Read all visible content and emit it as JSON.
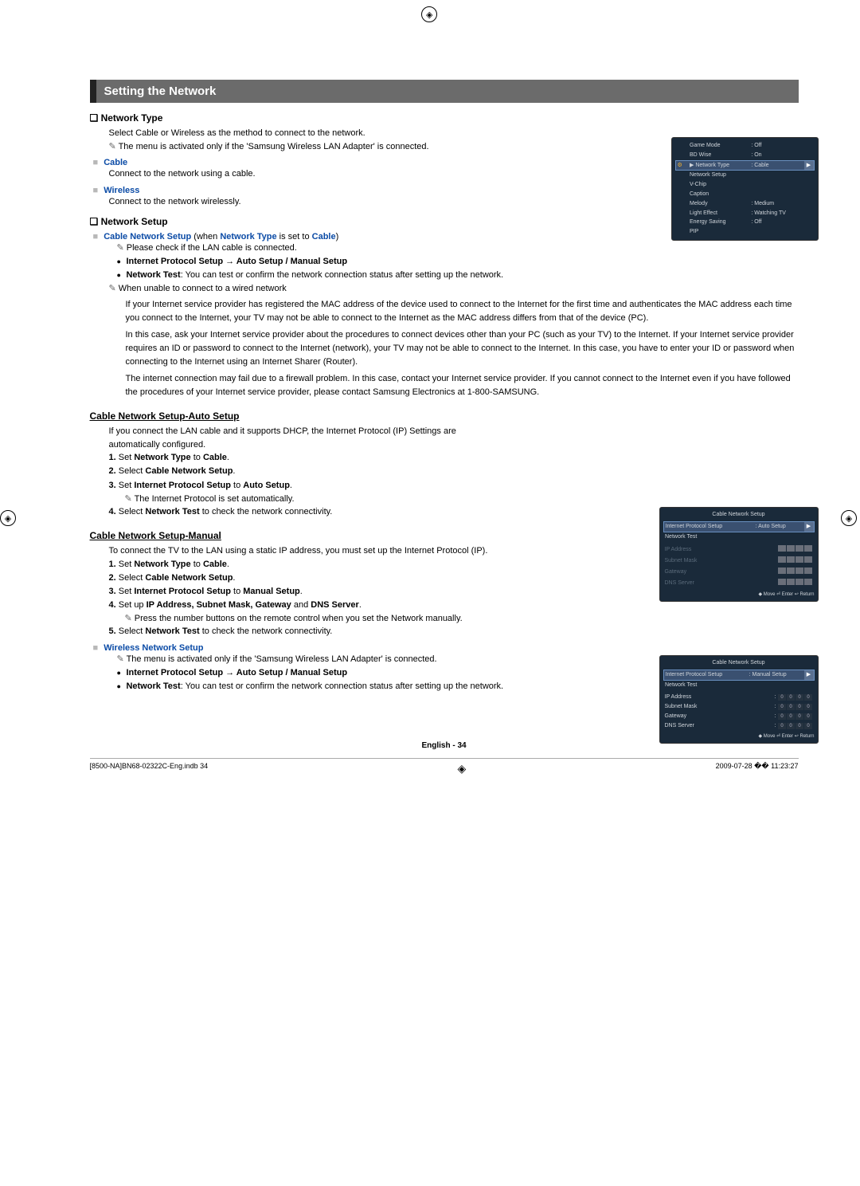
{
  "header": "Setting the Network",
  "network_type": {
    "heading": "Network Type",
    "intro": "Select Cable or Wireless as the method to connect to the network.",
    "note": "The menu is activated only if the 'Samsung Wireless LAN Adapter' is connected.",
    "cable_label": "Cable",
    "cable_text": "Connect to the network using a cable.",
    "wireless_label": "Wireless",
    "wireless_text": "Connect to the network wirelessly."
  },
  "network_setup": {
    "heading": "Network Setup",
    "cable_setup": "Cable Network Setup (when Network Type is set to Cable)",
    "check_lan": "Please check if the LAN cable is connected.",
    "ip_setup": "Internet Protocol Setup → Auto Setup / Manual Setup",
    "network_test_label": "Network Test",
    "network_test": ": You can test or confirm the network connection status after setting up the network.",
    "unable": "When unable to connect to a wired network",
    "para1": "If your Internet service provider has registered the MAC address of the device used to connect to the Internet for the first time and authenticates the MAC address each time you connect to the Internet, your TV may not be able to connect to the Internet as the MAC address differs from that of the device (PC).",
    "para2": "In this case, ask your Internet service provider about the procedures to connect devices other than your PC (such as your TV) to the Internet. If your Internet service provider requires an ID or password to connect to the Internet (network), your TV may not be able to connect to the Internet. In this case, you have to enter your ID or password when connecting to the Internet using an Internet Sharer (Router).",
    "para3": "The internet connection may fail due to a firewall problem. In this case, contact your Internet service provider. If you cannot connect to the Internet even if you have followed the procedures of your Internet service provider, please contact Samsung Electronics at 1-800-SAMSUNG."
  },
  "auto_setup": {
    "heading": "Cable Network Setup-Auto Setup",
    "intro": "If you connect the LAN cable and it supports DHCP, the Internet Protocol (IP) Settings are automatically configured.",
    "step1_pre": "Set ",
    "step1_b1": "Network Type",
    "step1_mid": " to ",
    "step1_b2": "Cable",
    "step1_end": ".",
    "step2_pre": "Select ",
    "step2_b": "Cable Network Setup",
    "step2_end": ".",
    "step3_pre": "Set ",
    "step3_b1": "Internet Protocol Setup",
    "step3_mid": " to ",
    "step3_b2": "Auto Setup",
    "step3_end": ".",
    "step3_note": "The Internet Protocol is set automatically.",
    "step4_pre": "Select ",
    "step4_b": "Network Test",
    "step4_end": " to check the network connectivity."
  },
  "manual_setup": {
    "heading": "Cable Network Setup-Manual",
    "intro": "To connect the TV to the LAN using a static IP address, you must set up the Internet Protocol (IP).",
    "step1_pre": "Set ",
    "step1_b1": "Network Type",
    "step1_mid": " to ",
    "step1_b2": "Cable",
    "step1_end": ".",
    "step2_pre": "Select ",
    "step2_b": "Cable Network Setup",
    "step2_end": ".",
    "step3_pre": "Set ",
    "step3_b1": "Internet Protocol Setup",
    "step3_mid": " to ",
    "step3_b2": "Manual Setup",
    "step3_end": ".",
    "step4_pre": "Set up ",
    "step4_b": "IP Address, Subnet Mask, Gateway",
    "step4_mid": " and ",
    "step4_b2": "DNS Server",
    "step4_end": ".",
    "step4_note": "Press the number buttons on the remote control when you set the Network manually.",
    "step5_pre": "Select ",
    "step5_b": "Network Test",
    "step5_end": " to check the network connectivity."
  },
  "wireless_setup": {
    "label": "Wireless Network Setup",
    "note": "The menu is activated only if the 'Samsung Wireless LAN Adapter' is connected.",
    "ip_setup": "Internet Protocol Setup → Auto Setup / Manual Setup",
    "network_test_label": "Network Test",
    "network_test": ": You can test or confirm the network connection status after setting up the network."
  },
  "osd_menu": {
    "game_mode": "Game Mode",
    "game_mode_v": ": Off",
    "bd_wise": "BD Wise",
    "bd_wise_v": ": On",
    "network_type": "▶ Network Type",
    "network_type_v": ": Cable",
    "network_setup": "Network Setup",
    "vchip": "V-Chip",
    "caption": "Caption",
    "melody": "Melody",
    "melody_v": ": Medium",
    "light": "Light Effect",
    "light_v": ": Watching TV",
    "energy": "Energy Saving",
    "energy_v": ": Off",
    "pip": "PIP",
    "side_label": "Setup"
  },
  "osd_auto": {
    "title": "Cable Network Setup",
    "ips": "Internet Protocol Setup",
    "ips_v": ": Auto Setup",
    "ntest": "Network Test",
    "ip": "IP Address",
    "mask": "Subnet Mask",
    "gw": "Gateway",
    "dns": "DNS Server",
    "foot": "◆ Move    ⏎ Enter    ↩ Return"
  },
  "osd_manual": {
    "title": "Cable Network Setup",
    "ips": "Internet Protocol Setup",
    "ips_v": ": Manual Setup",
    "ntest": "Network Test",
    "ip": "IP Address",
    "mask": "Subnet Mask",
    "gw": "Gateway",
    "dns": "DNS Server",
    "foot": "◆ Move    ⏎ Enter    ↩ Return"
  },
  "footer": {
    "center": "English - 34",
    "left": "[8500-NA]BN68-02322C-Eng.indb   34",
    "right": "2009-07-28   �� 11:23:27"
  }
}
